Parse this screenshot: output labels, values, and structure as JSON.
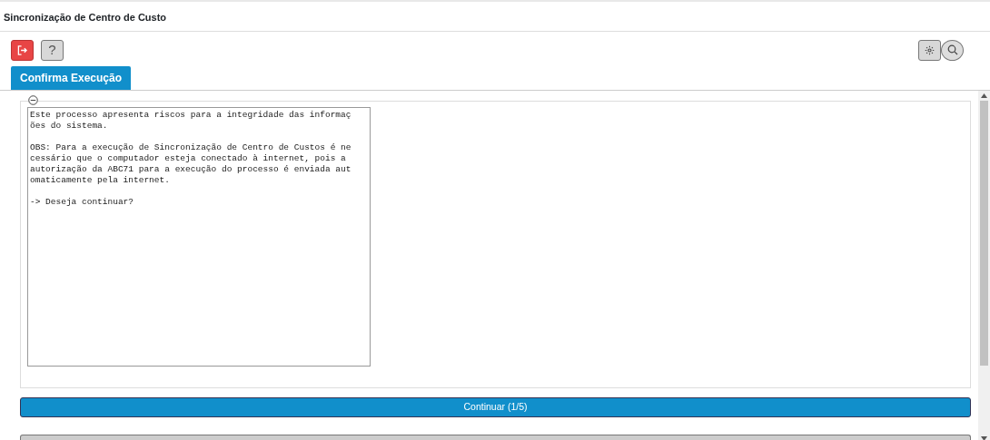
{
  "window": {
    "title": "Sincronização de Centro de Custo"
  },
  "toolbar": [
    {
      "kind": "exit"
    },
    {
      "kind": "help",
      "label": "?"
    }
  ],
  "tools": [
    {
      "kind": "settings"
    },
    {
      "kind": "search"
    }
  ],
  "tabs": [
    {
      "label": "Confirma Execução",
      "selected": true
    }
  ],
  "panel": {
    "expanded": true,
    "message": "Este processo apresenta riscos para a integridade das informações do sistema.\n\nOBS: Para a execução de Sincronização de Centro de Custos é necessário que o computador esteja conectado à internet, pois a autorização da ABC71 para a execução do processo é enviada automaticamente pela internet.\n\n-> Deseja continuar?"
  },
  "buttons": [
    {
      "label": "Continuar (1/5)",
      "kind": "primary"
    },
    {
      "kind": "secondary"
    }
  ]
}
